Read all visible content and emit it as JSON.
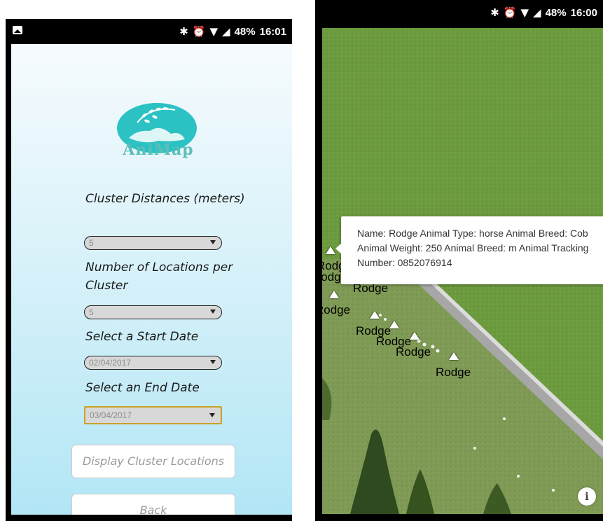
{
  "left_screen": {
    "status_bar": {
      "notification_icon": "image-icon",
      "status_icons": [
        "bluetooth-icon",
        "alarm-icon",
        "wifi-icon",
        "signal-icon"
      ],
      "battery": "48%",
      "time": "16:01"
    },
    "logo_text": "AniMap",
    "cluster_distances": {
      "label": "Cluster Distances (meters)",
      "value": "5"
    },
    "locations_per_cluster": {
      "label": "Number of Locations per Cluster",
      "value": "5"
    },
    "start_date": {
      "label": "Select a Start Date",
      "value": "02/04/2017"
    },
    "end_date": {
      "label": "Select an End Date",
      "value": "03/04/2017"
    },
    "display_button": "Display Cluster Locations",
    "back_button": "Back"
  },
  "right_screen": {
    "status_bar": {
      "status_icons": [
        "bluetooth-icon",
        "alarm-icon",
        "wifi-icon",
        "signal-icon"
      ],
      "battery": "48%",
      "time": "16:00"
    },
    "popup": {
      "text": "Name: Rodge Animal Type: horse Animal Breed: Cob Animal Weight: 250 Animal Breed: m Animal Tracking Number: 0852076914",
      "close_glyph": "×"
    },
    "markers": [
      {
        "label": "Rodge"
      },
      {
        "label": "Rodge"
      },
      {
        "label": "Rodge"
      },
      {
        "label": "Rodge"
      },
      {
        "label": "Rodge"
      },
      {
        "label": "Rodge"
      },
      {
        "label": "Rodge"
      },
      {
        "label": "Rodge"
      }
    ],
    "info_icon": "info-icon",
    "info_glyph": "i"
  },
  "colors": {
    "field_green": "#6c9a3e",
    "field_lower": "#7f9a55",
    "road": "#a7a7a7",
    "gradient_bottom": "#b2e6f5",
    "logo_teal": "#2cc1c3"
  }
}
